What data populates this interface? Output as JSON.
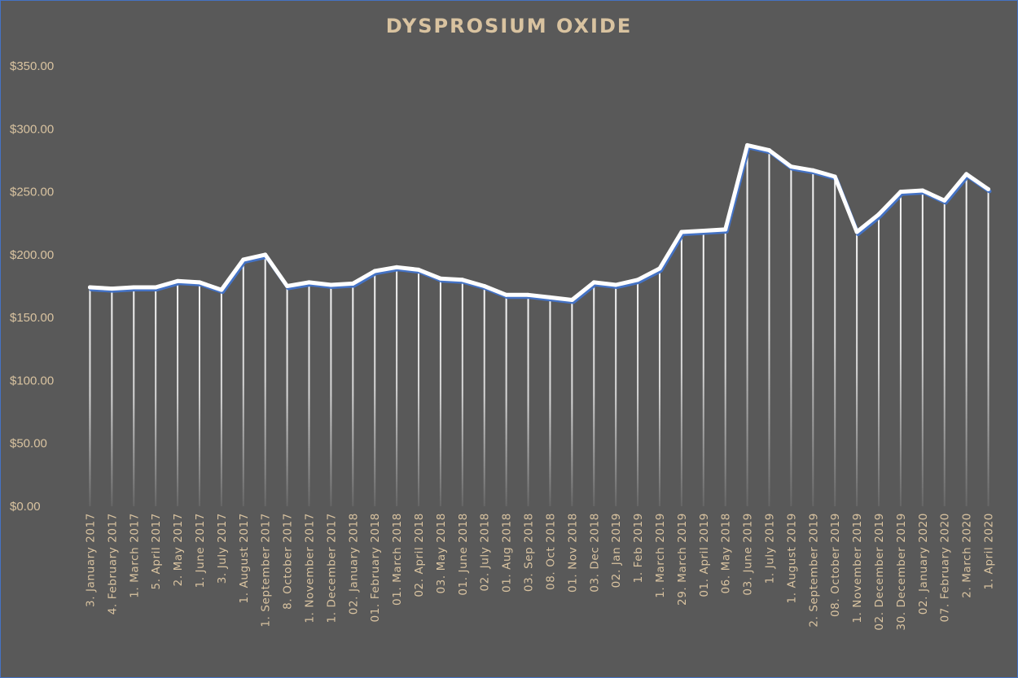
{
  "chart_data": {
    "type": "line",
    "title": "DYSPROSIUM OXIDE",
    "xlabel": "",
    "ylabel": "",
    "ylim": [
      0,
      350
    ],
    "yticks": [
      "$0.00",
      "$50.00",
      "$100.00",
      "$150.00",
      "$200.00",
      "$250.00",
      "$300.00",
      "$350.00"
    ],
    "grid": false,
    "drop_lines": true,
    "line_color": "#ffffff",
    "shadow_color": "#4472c4",
    "text_color": "#d9c3a0",
    "background": "#595959",
    "categories": [
      "3. January 2017",
      "4. February 2017",
      "1. March 2017",
      "5. April 2017",
      "2. May 2017",
      "1. June 2017",
      "3. July 2017",
      "1. August 2017",
      "1. September 2017",
      "8. October 2017",
      "1. November 2017",
      "1. December 2017",
      "02. January 2018",
      "01. February 2018",
      "01. March 2018",
      "02. April 2018",
      "03. May 2018",
      "01. June 2018",
      "02. July 2018",
      "01. Aug 2018",
      "03. Sep 2018",
      "08. Oct 2018",
      "01. Nov 2018",
      "03. Dec 2018",
      "02. Jan 2019",
      "1. Feb 2019",
      "1. March 2019",
      "29. March 2019",
      "01. April 2019",
      "06. May 2018",
      "03. June 2019",
      "1. July 2019",
      "1. August 2019",
      "2. September 2019",
      "08. October 2019",
      "1. November 2019",
      "02. December 2019",
      "30. December 2019",
      "02. January 2020",
      "07. February 2020",
      "2. March 2020",
      "1. April 2020"
    ],
    "series": [
      {
        "values": [
          174,
          173,
          174,
          174,
          179,
          178,
          172,
          196,
          200,
          175,
          178,
          176,
          177,
          187,
          190,
          188,
          181,
          180,
          175,
          168,
          168,
          166,
          164,
          178,
          176,
          180,
          189,
          218,
          219,
          220,
          287,
          283,
          270,
          267,
          262,
          218,
          232,
          250,
          251,
          243,
          264,
          252
        ]
      }
    ]
  }
}
